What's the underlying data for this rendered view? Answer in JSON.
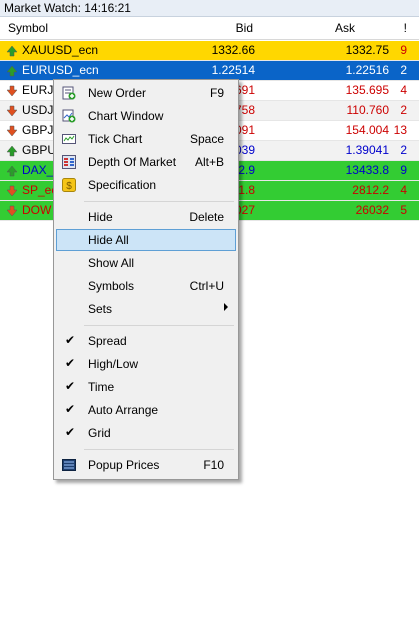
{
  "window": {
    "title": "Market Watch:  14:16:21"
  },
  "columns": {
    "symbol": "Symbol",
    "bid": "Bid",
    "ask": "Ask",
    "spread": "!"
  },
  "rows": [
    {
      "symbol": "XAUUSD_ecn",
      "bid": "1332.66",
      "ask": "1332.75",
      "spread": "9",
      "bg": "#ffd700",
      "text": "#000000",
      "spread_color": "#cc0000",
      "dir": "up"
    },
    {
      "symbol": "EURUSD_ecn",
      "bid": "1.22514",
      "ask": "1.22516",
      "spread": "2",
      "bg": "#0a64c8",
      "text": "#ffffff",
      "spread_color": "#ffffff",
      "dir": "up"
    },
    {
      "symbol": "EURJP",
      "bid": "691",
      "ask": "135.695",
      "spread": "4",
      "bg": "#ffffff",
      "text": "#cc0000",
      "spread_color": "#cc0000",
      "dir": "down"
    },
    {
      "symbol": "USDJP",
      "bid": "758",
      "ask": "110.760",
      "spread": "2",
      "bg": "#f2f2f2",
      "text": "#cc0000",
      "spread_color": "#cc0000",
      "dir": "down"
    },
    {
      "symbol": "GBPJP",
      "bid": "091",
      "ask": "154.004",
      "spread": "13",
      "bg": "#ffffff",
      "text": "#cc0000",
      "spread_color": "#cc0000",
      "dir": "down"
    },
    {
      "symbol": "GBPU",
      "bid": "039",
      "ask": "1.39041",
      "spread": "2",
      "bg": "#f2f2f2",
      "text": "#0000cc",
      "spread_color": "#0000cc",
      "dir": "up"
    },
    {
      "symbol": "DAX_",
      "bid": "2.9",
      "ask": "13433.8",
      "spread": "9",
      "bg": "#33cc33",
      "text": "#0000cc",
      "spread_color": "#0000cc",
      "dir": "up"
    },
    {
      "symbol": "SP_ec",
      "bid": "1.8",
      "ask": "2812.2",
      "spread": "4",
      "bg": "#33cc33",
      "text": "#cc0000",
      "spread_color": "#cc0000",
      "dir": "down"
    },
    {
      "symbol": "DOW",
      "bid": "027",
      "ask": "26032",
      "spread": "5",
      "bg": "#33cc33",
      "text": "#cc0000",
      "spread_color": "#cc0000",
      "dir": "down"
    }
  ],
  "menu": {
    "new_order": {
      "label": "New Order",
      "key": "F9",
      "icon": "new-order-icon"
    },
    "chart_window": {
      "label": "Chart Window",
      "icon": "chart-window-icon"
    },
    "tick_chart": {
      "label": "Tick Chart",
      "key": "Space",
      "icon": "tick-chart-icon"
    },
    "depth_of_market": {
      "label": "Depth Of Market",
      "key": "Alt+B",
      "icon": "depth-of-market-icon"
    },
    "specification": {
      "label": "Specification",
      "icon": "specification-icon"
    },
    "hide": {
      "label": "Hide",
      "key": "Delete"
    },
    "hide_all": {
      "label": "Hide All"
    },
    "show_all": {
      "label": "Show All"
    },
    "symbols": {
      "label": "Symbols",
      "key": "Ctrl+U"
    },
    "sets": {
      "label": "Sets"
    },
    "spread": {
      "label": "Spread",
      "checked": true
    },
    "high_low": {
      "label": "High/Low",
      "checked": true
    },
    "time": {
      "label": "Time",
      "checked": true
    },
    "auto_arrange": {
      "label": "Auto Arrange",
      "checked": true
    },
    "grid": {
      "label": "Grid",
      "checked": true
    },
    "popup_prices": {
      "label": "Popup Prices",
      "key": "F10",
      "icon": "popup-prices-icon"
    },
    "check_glyph": "✔"
  }
}
